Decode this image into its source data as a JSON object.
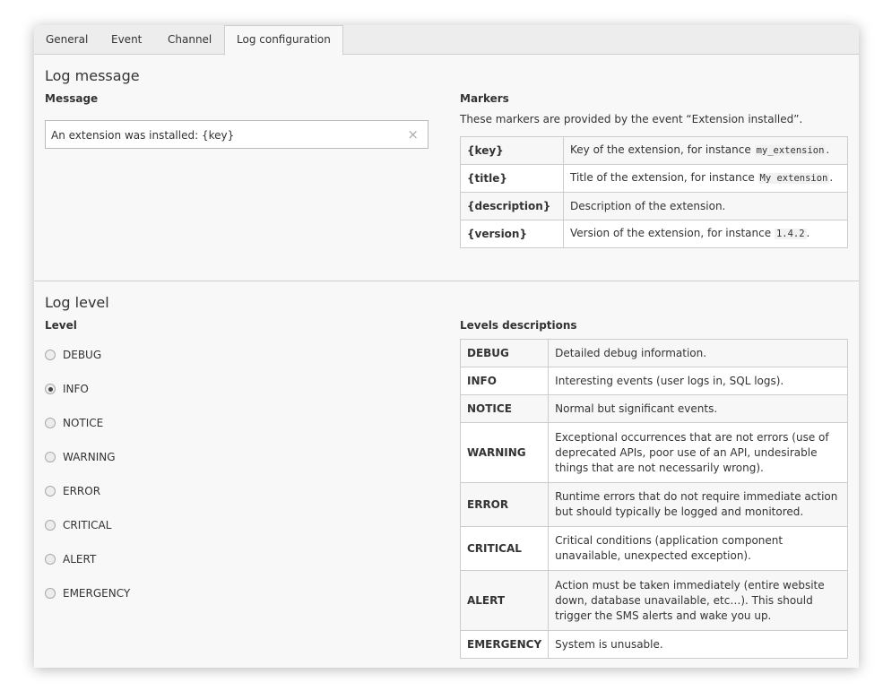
{
  "tabs": [
    {
      "label": "General"
    },
    {
      "label": "Event"
    },
    {
      "label": "Channel"
    },
    {
      "label": "Log configuration",
      "active": true
    }
  ],
  "log_message": {
    "section_title": "Log message",
    "message_label": "Message",
    "message_value": "An extension was installed: {key}",
    "clear_icon": "×",
    "markers_label": "Markers",
    "markers_intro": "These markers are provided by the event “Extension installed”.",
    "markers": [
      {
        "key": "{key}",
        "desc": "Key of the extension, for instance ",
        "code": "my_extension",
        "suffix": "."
      },
      {
        "key": "{title}",
        "desc": "Title of the extension, for instance ",
        "code": "My extension",
        "suffix": "."
      },
      {
        "key": "{description}",
        "desc": "Description of the extension.",
        "code": "",
        "suffix": ""
      },
      {
        "key": "{version}",
        "desc": "Version of the extension, for instance ",
        "code": "1.4.2",
        "suffix": "."
      }
    ]
  },
  "log_level": {
    "section_title": "Log level",
    "level_label": "Level",
    "selected": "INFO",
    "options": [
      "DEBUG",
      "INFO",
      "NOTICE",
      "WARNING",
      "ERROR",
      "CRITICAL",
      "ALERT",
      "EMERGENCY"
    ],
    "descriptions_label": "Levels descriptions",
    "descriptions": [
      {
        "level": "DEBUG",
        "desc": "Detailed debug information."
      },
      {
        "level": "INFO",
        "desc": "Interesting events (user logs in, SQL logs)."
      },
      {
        "level": "NOTICE",
        "desc": "Normal but significant events."
      },
      {
        "level": "WARNING",
        "desc": "Exceptional occurrences that are not errors (use of deprecated APIs, poor use of an API, undesirable things that are not necessarily wrong)."
      },
      {
        "level": "ERROR",
        "desc": "Runtime errors that do not require immediate action but should typically be logged and monitored."
      },
      {
        "level": "CRITICAL",
        "desc": "Critical conditions (application component unavailable, unexpected exception)."
      },
      {
        "level": "ALERT",
        "desc": "Action must be taken immediately (entire website down, database unavailable, etc…). This should trigger the SMS alerts and wake you up."
      },
      {
        "level": "EMERGENCY",
        "desc": "System is unusable."
      }
    ]
  }
}
